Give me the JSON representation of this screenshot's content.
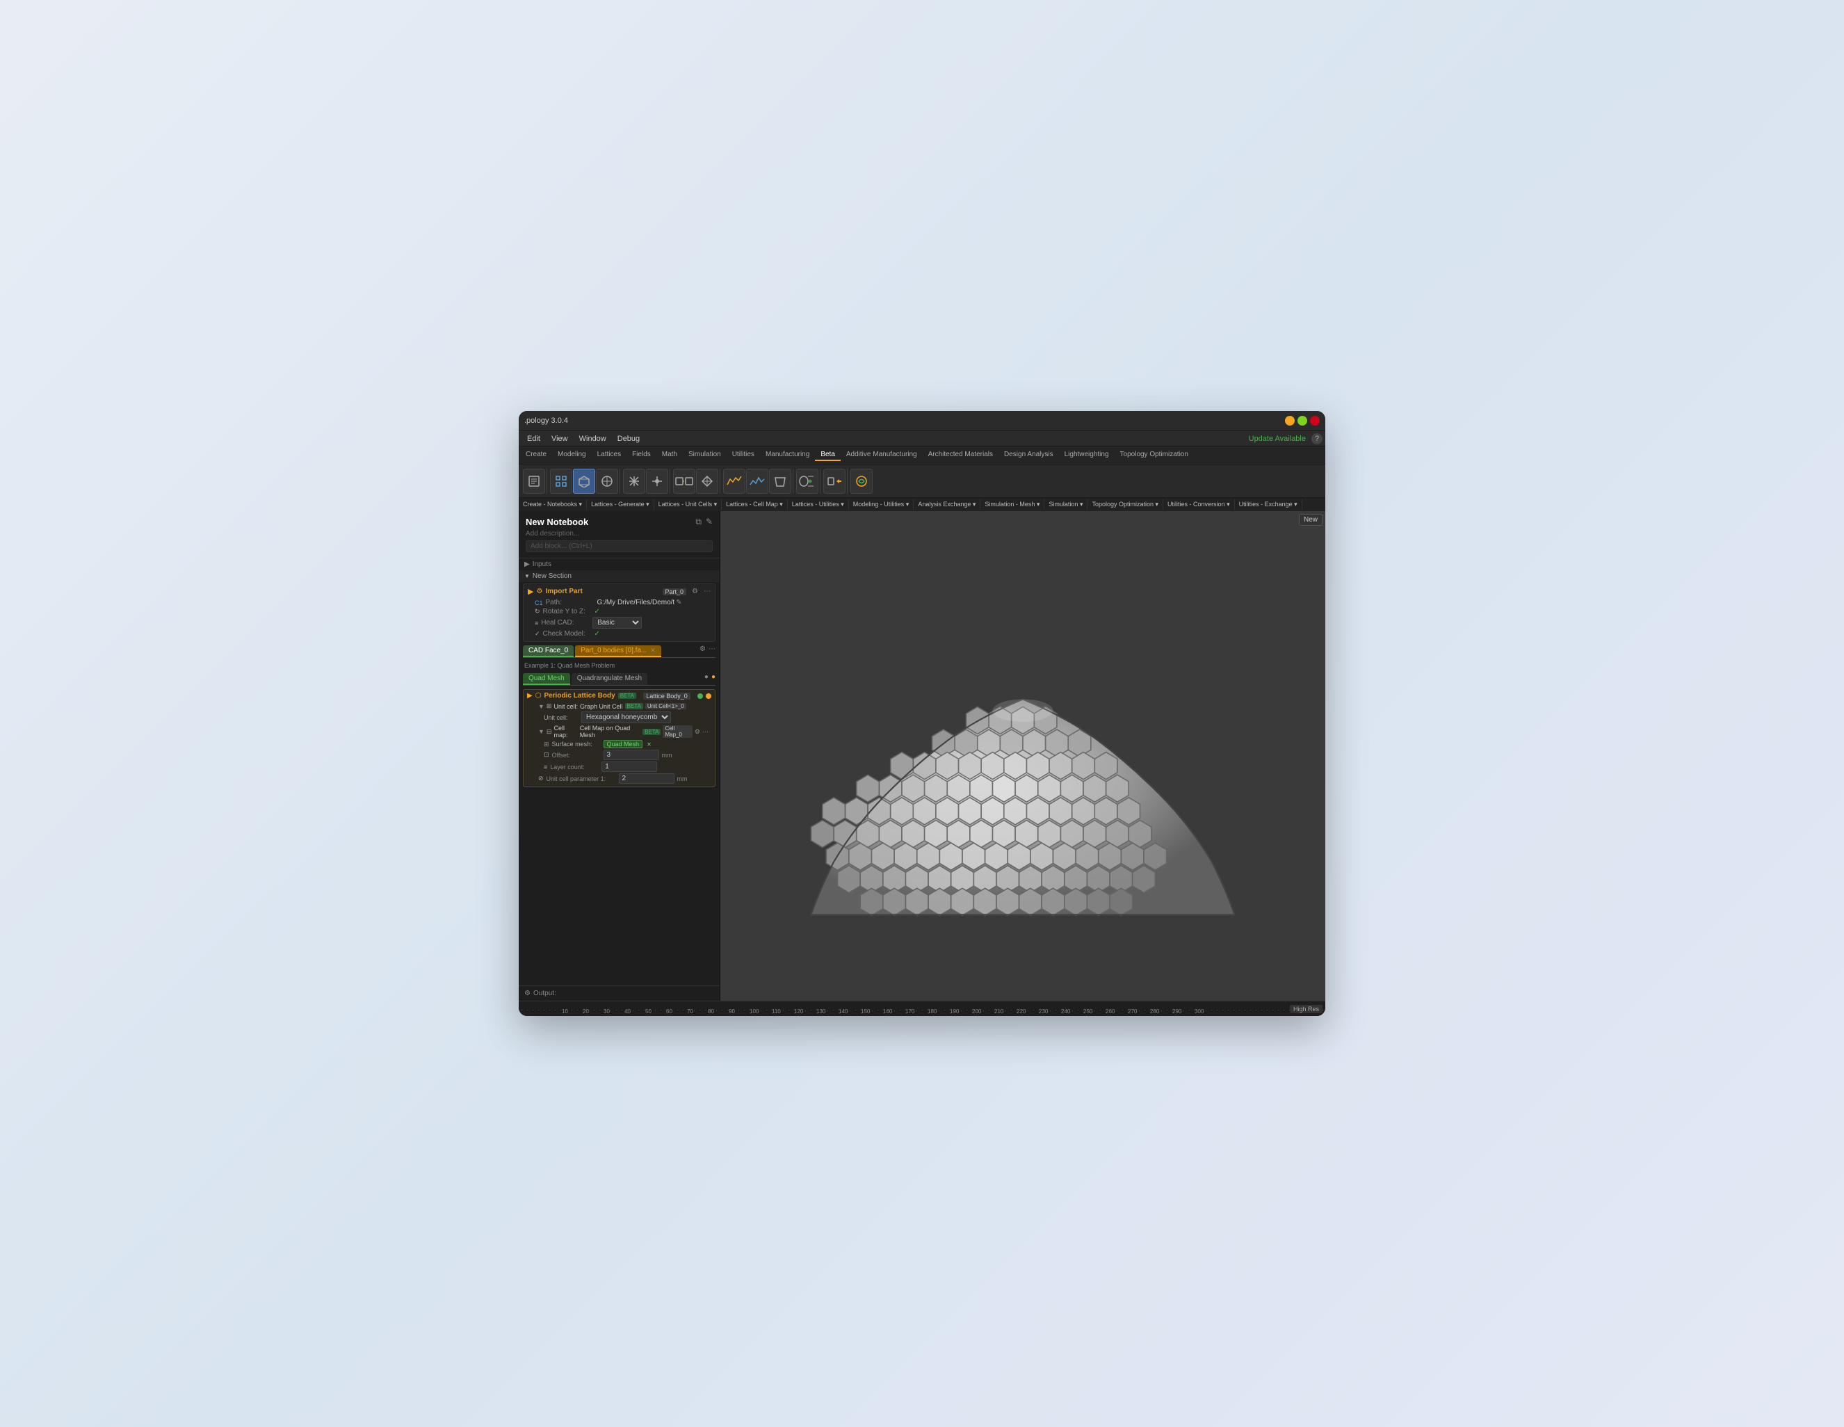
{
  "window": {
    "title": ".pology 3.0.4",
    "buttons": [
      "minimize",
      "maximize",
      "close"
    ]
  },
  "menu": {
    "items": [
      "Edit",
      "View",
      "Window",
      "Debug"
    ],
    "update_label": "Update Available",
    "help_label": "?"
  },
  "tabs": {
    "items": [
      "Create",
      "Modeling",
      "Lattices",
      "Fields",
      "Math",
      "Simulation",
      "Utilities",
      "Manufacturing",
      "Beta",
      "Additive Manufacturing",
      "Architected Materials",
      "Design Analysis",
      "Lightweighting",
      "Topology Optimization"
    ],
    "active": "Beta"
  },
  "dropdown_bar": {
    "items": [
      "Create - Notebooks ▾",
      "Lattices - Generate ▾",
      "Lattices - Unit Cells ▾",
      "Lattices - Cell Map ▾",
      "Lattices - Utilities ▾",
      "Modeling - Utilities ▾",
      "Analysis Exchange ▾",
      "Simulation - Mesh ▾",
      "Simulation ▾",
      "Topology Optimization ▾",
      "Utilities - Conversion ▾",
      "Utilities - Exchange ▾"
    ]
  },
  "notebook": {
    "title": "New Notebook",
    "description_placeholder": "Add description...",
    "add_block_label": "Add block... (Ctrl+L)"
  },
  "sidebar": {
    "inputs_label": "Inputs",
    "new_section_label": "New Section",
    "import_part": {
      "name": "Import Part",
      "badge": "Part_0",
      "props": {
        "path_label": "Path:",
        "path_value": "G:/My Drive/Files/Demo/t",
        "rotate_label": "Rotate Y to Z:",
        "rotate_value": "✓",
        "heal_label": "Heal CAD:",
        "heal_value": "Basic",
        "check_label": "Check Model:",
        "check_value": "✓"
      }
    },
    "cad_face_tab": "CAD Face_0",
    "part_bodies_tab": "Part_0 bodies [0].fa...",
    "example_label": "Example 1: Quad Mesh Problem",
    "quad_mesh_tab": "Quad Mesh",
    "quadrangulate_tab": "Quadrangulate Mesh",
    "lattice_body": {
      "name": "Periodic Lattice Body",
      "beta_label": "BETA",
      "badge": "Lattice Body_0",
      "unit_cell_label": "Unit cell:",
      "unit_cell_sub": "Graph Unit Cell",
      "unit_cell_badge": "BETA",
      "unit_cell_ref": "Unit Cell<1>_0",
      "unit_cell_type_label": "Unit cell:",
      "unit_cell_type_value": "Hexagonal honeycomb",
      "cell_map_label": "Cell map:",
      "cell_map_sub": "Cell Map on Quad Mesh",
      "cell_map_badge": "BETA",
      "cell_map_ref": "Cell Map_0",
      "surface_mesh_label": "Surface mesh:",
      "surface_mesh_tag": "Quad Mesh",
      "offset_label": "Offset:",
      "offset_value": "3",
      "offset_unit": "mm",
      "layer_label": "Layer count:",
      "layer_value": "1",
      "param_label": "Unit cell parameter 1:",
      "param_value": "2",
      "param_unit": "mm"
    }
  },
  "output_bar": {
    "label": "Output:"
  },
  "ruler": {
    "numbers": [
      "10",
      "20",
      "30",
      "40",
      "50",
      "60",
      "70",
      "80",
      "90",
      "100",
      "110",
      "120",
      "130",
      "140",
      "150",
      "160",
      "170",
      "180",
      "190",
      "200",
      "210",
      "220",
      "230",
      "240",
      "250",
      "260",
      "270",
      "280",
      "290",
      "300"
    ]
  },
  "viewport": {
    "new_btn": "New",
    "high_res_label": "High Res"
  },
  "colors": {
    "bg": "#1e1e1e",
    "sidebar_bg": "#1e1e1e",
    "toolbar_bg": "#2a2a2a",
    "accent_orange": "#f5a623",
    "accent_green": "#4CAF50",
    "accent_blue": "#5a9fd4",
    "active_tab": "#f5a623"
  }
}
